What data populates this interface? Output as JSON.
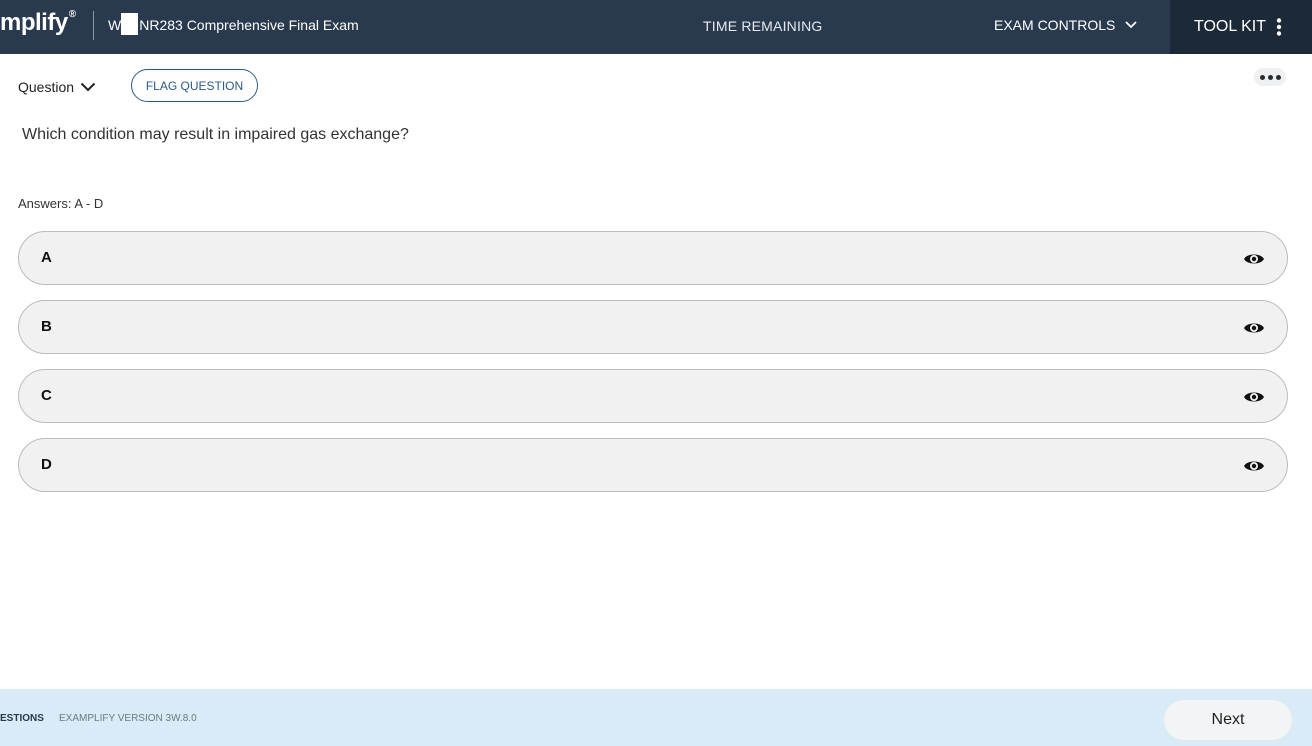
{
  "header": {
    "logo": "mplify",
    "logo_mark": "®",
    "exam_title_prefix": "W",
    "exam_title": "NR283 Comprehensive Final Exam",
    "exam_subtitle": "",
    "time_label": "TIME REMAINING",
    "time_value": "",
    "exam_controls_label": "EXAM CONTROLS",
    "toolkit_label": "TOOL KIT"
  },
  "question_bar": {
    "question_label": "Question",
    "question_number": "",
    "flag_label": "FLAG QUESTION"
  },
  "question": {
    "text": "Which condition may result in impaired gas exchange?",
    "answers_range": "Answers: A - D"
  },
  "options": [
    {
      "letter": "A",
      "text": ""
    },
    {
      "letter": "B",
      "text": ""
    },
    {
      "letter": "C",
      "text": ""
    },
    {
      "letter": "D",
      "text": ""
    }
  ],
  "footer": {
    "questions_label": "ESTIONS",
    "version_text": "EXAMPLIFY VERSION 3W.8.0",
    "next_label": "Next"
  },
  "colors": {
    "header_bg": "#2a3a4e",
    "toolkit_bg": "#1c2938",
    "accent": "#2a5a8c",
    "footer_bg": "#d9ebf6"
  }
}
